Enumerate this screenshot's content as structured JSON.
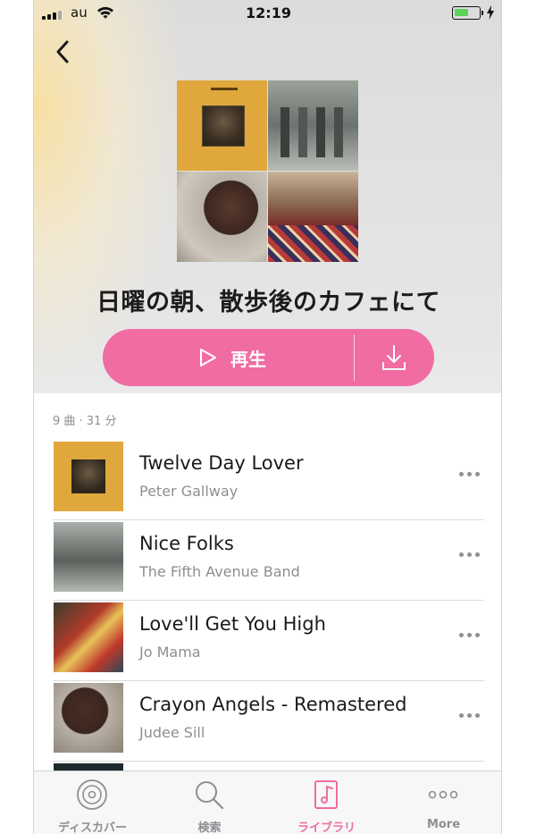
{
  "status_bar": {
    "carrier": "au",
    "time": "12:19"
  },
  "playlist": {
    "title": "日曜の朝、散歩後のカフェにて",
    "play_label": "再生",
    "meta": "9 曲 · 31 分"
  },
  "tracks": [
    {
      "title": "Twelve Day Lover",
      "artist": "Peter Gallway"
    },
    {
      "title": "Nice Folks",
      "artist": "The Fifth Avenue Band"
    },
    {
      "title": "Love'll Get You High",
      "artist": "Jo Mama"
    },
    {
      "title": "Crayon Angels - Remastered",
      "artist": "Judee Sill"
    }
  ],
  "tabbar": {
    "items": [
      {
        "label": "ディスカバー",
        "icon": "discover-icon"
      },
      {
        "label": "検索",
        "icon": "search-icon"
      },
      {
        "label": "ライブラリ",
        "icon": "library-icon",
        "active": true
      },
      {
        "label": "More",
        "icon": "more-icon"
      }
    ]
  },
  "colors": {
    "accent": "#f06ca3",
    "secondary_text": "#8e8e93",
    "battery": "#5bd35b"
  }
}
